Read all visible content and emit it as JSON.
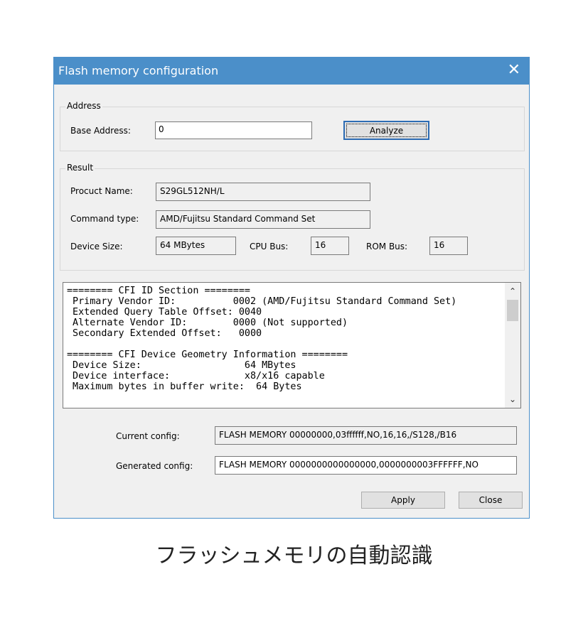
{
  "window": {
    "title": "Flash memory configuration",
    "close_glyph": "✕"
  },
  "address": {
    "group_label": "Address",
    "base_label": "Base Address:",
    "base_value": "0",
    "analyze_label": "Analyze"
  },
  "result": {
    "group_label": "Result",
    "product_label": "Procuct Name:",
    "product_value": "S29GL512NH/L",
    "command_label": "Command type:",
    "command_value": "AMD/Fujitsu Standard Command Set",
    "device_label": "Device Size:",
    "device_value": "64 MBytes",
    "cpu_label": "CPU Bus:",
    "cpu_value": "16",
    "rom_label": "ROM Bus:",
    "rom_value": "16"
  },
  "log": {
    "text": "======== CFI ID Section ========\n Primary Vendor ID:          0002 (AMD/Fujitsu Standard Command Set)\n Extended Query Table Offset: 0040\n Alternate Vendor ID:        0000 (Not supported)\n Secondary Extended Offset:   0000\n\n======== CFI Device Geometry Information ========\n Device Size:                  64 MBytes\n Device interface:             x8/x16 capable\n Maximum bytes in buffer write:  64 Bytes",
    "scroll_up_icon": "chevron-up-icon",
    "scroll_down_icon": "chevron-down-icon"
  },
  "config": {
    "current_label": "Current config:",
    "current_value": "FLASH MEMORY 00000000,03ffffff,NO,16,16,/S128,/B16",
    "generated_label": "Generated config:",
    "generated_value": "FLASH MEMORY 0000000000000000,0000000003FFFFFF,NO"
  },
  "buttons": {
    "apply": "Apply",
    "close": "Close"
  },
  "caption": "フラッシュメモリの自動認識",
  "colors": {
    "titlebar": "#4b8fc9",
    "dialog_bg": "#f0f0f0"
  }
}
